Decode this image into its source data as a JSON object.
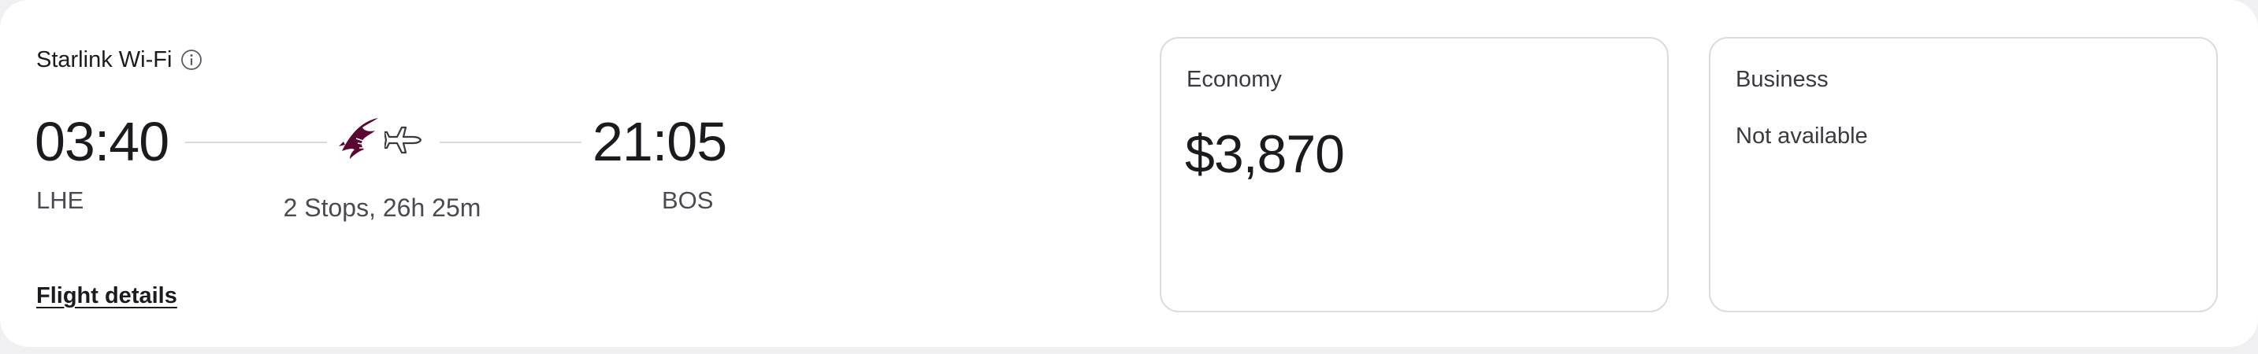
{
  "amenity": {
    "wifi_label": "Starlink Wi-Fi",
    "info_icon": "info-icon"
  },
  "flight": {
    "departure_time": "03:40",
    "arrival_time": "21:05",
    "origin": "LHE",
    "destination": "BOS",
    "stops_duration": "2 Stops, 26h 25m",
    "airline_logo_icon": "airline-oryx-logo-icon",
    "plane_icon": "airplane-icon",
    "brand_color": "#5c0632"
  },
  "links": {
    "flight_details": "Flight details"
  },
  "fares": {
    "economy": {
      "label": "Economy",
      "price": "$3,870"
    },
    "business": {
      "label": "Business",
      "status": "Not available"
    }
  }
}
